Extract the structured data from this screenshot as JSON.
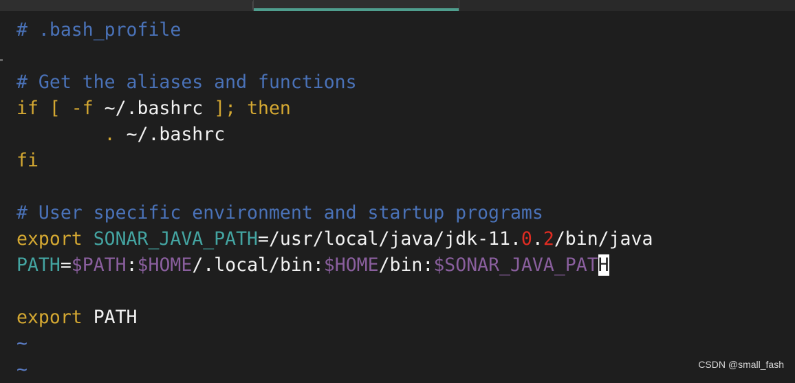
{
  "editor": {
    "lines": [
      [
        {
          "t": ".bash_profile",
          "k": "c-comment",
          "pre": "# "
        }
      ],
      [],
      [
        {
          "t": "# Get the aliases and functions",
          "k": "c-comment"
        }
      ],
      [
        {
          "t": "if ",
          "k": "c-keyword"
        },
        {
          "t": "[ -f ",
          "k": "c-keyword"
        },
        {
          "t": "~/.bashrc ",
          "k": "c-default"
        },
        {
          "t": "]; then",
          "k": "c-keyword"
        }
      ],
      [
        {
          "t": "        ",
          "k": "c-default"
        },
        {
          "t": ". ",
          "k": "c-keyword"
        },
        {
          "t": "~/.bashrc",
          "k": "c-default"
        }
      ],
      [
        {
          "t": "fi",
          "k": "c-keyword"
        }
      ],
      [],
      [
        {
          "t": "# User specific environment and startup programs",
          "k": "c-comment"
        }
      ],
      [
        {
          "t": "export ",
          "k": "c-keyword"
        },
        {
          "t": "SONAR_JAVA_PATH",
          "k": "c-var"
        },
        {
          "t": "=/usr/local/java/jdk-11.",
          "k": "c-default"
        },
        {
          "t": "0",
          "k": "c-red"
        },
        {
          "t": ".",
          "k": "c-default"
        },
        {
          "t": "2",
          "k": "c-red"
        },
        {
          "t": "/bin/java",
          "k": "c-default"
        }
      ],
      [
        {
          "t": "PATH",
          "k": "c-var"
        },
        {
          "t": "=",
          "k": "c-default"
        },
        {
          "t": "$PATH",
          "k": "c-dollar"
        },
        {
          "t": ":",
          "k": "c-default"
        },
        {
          "t": "$HOME",
          "k": "c-dollar"
        },
        {
          "t": "/.local/bin:",
          "k": "c-default"
        },
        {
          "t": "$HOME",
          "k": "c-dollar"
        },
        {
          "t": "/bin:",
          "k": "c-default"
        },
        {
          "t": "$SONAR_JAVA_PAT",
          "k": "c-dollar"
        },
        {
          "t": "H",
          "k": "cursor"
        }
      ],
      [],
      [
        {
          "t": "export ",
          "k": "c-keyword"
        },
        {
          "t": "PATH",
          "k": "c-default"
        }
      ],
      [
        {
          "t": "~",
          "k": "c-tilde"
        }
      ],
      [
        {
          "t": "~",
          "k": "c-tilde"
        }
      ]
    ]
  },
  "watermark": "CSDN @small_fash"
}
